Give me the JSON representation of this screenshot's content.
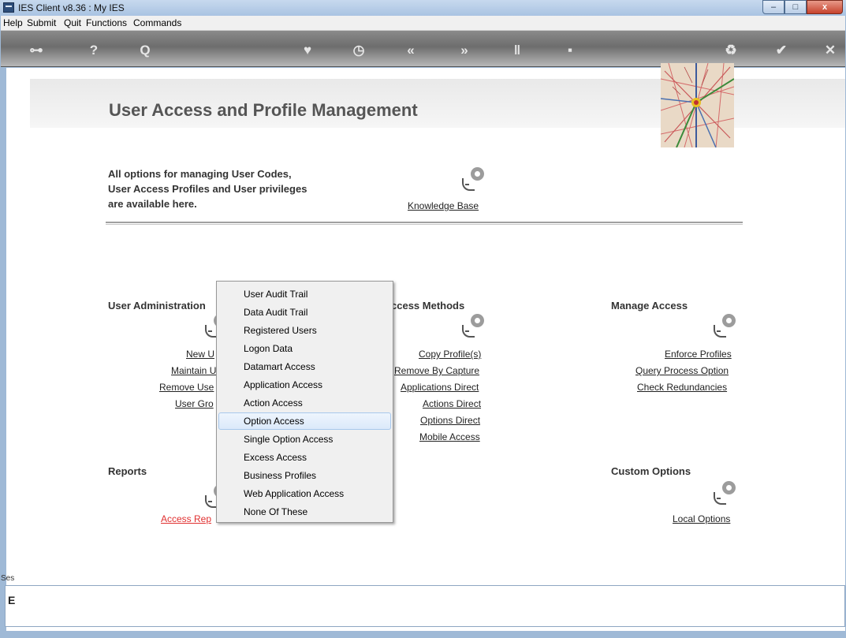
{
  "window": {
    "title": "IES Client v8.36 : My IES"
  },
  "window_controls": {
    "minimize": "–",
    "maximize": "□",
    "close": "x"
  },
  "menubar": [
    "Help",
    "Submit",
    "Quit",
    "Functions",
    "Commands"
  ],
  "toolbar": [
    {
      "icon": "key-icon",
      "glyph": "⊶"
    },
    {
      "icon": "help-icon",
      "glyph": "?"
    },
    {
      "icon": "search-icon",
      "glyph": "Q"
    },
    {
      "icon": "heart-icon",
      "glyph": "♥"
    },
    {
      "icon": "clock-icon",
      "glyph": "◷"
    },
    {
      "icon": "back-icon",
      "glyph": "«"
    },
    {
      "icon": "forward-icon",
      "glyph": "»"
    },
    {
      "icon": "tools-icon",
      "glyph": "ǁ"
    },
    {
      "icon": "calculator-icon",
      "glyph": "▪"
    },
    {
      "icon": "recycle-icon",
      "glyph": "♻"
    },
    {
      "icon": "check-icon",
      "glyph": "✔"
    },
    {
      "icon": "close-icon",
      "glyph": "✕"
    }
  ],
  "page": {
    "title": "User Access and Profile Management",
    "intro": [
      "All options for managing User Codes,",
      "User Access Profiles and User privileges",
      "are available here."
    ],
    "knowledge_base": "Knowledge Base"
  },
  "sections": {
    "user_admin": {
      "title": "User Administration",
      "links": [
        "New U",
        "Maintain U",
        "Remove Use",
        "User Gro"
      ]
    },
    "access_methods": {
      "title": "ccess Methods",
      "links": [
        "Copy Profile(s)",
        "Remove By Capture",
        "Applications Direct",
        "Actions Direct",
        "Options Direct",
        "Mobile Access"
      ]
    },
    "manage_access": {
      "title": "Manage Access",
      "links": [
        "Enforce Profiles",
        "Query Process Option",
        "Check Redundancies"
      ]
    },
    "reports": {
      "title": "Reports",
      "links": [
        "Access Rep"
      ]
    },
    "custom_options": {
      "title": "Custom Options",
      "links": [
        "Local Options"
      ]
    }
  },
  "popup_menu": {
    "items": [
      "User Audit Trail",
      "Data Audit Trail",
      "Registered Users",
      "Logon Data",
      "Datamart Access",
      "Application Access",
      "Action Access",
      "Option Access",
      "Single Option Access",
      "Excess Access",
      "Business Profiles",
      "Web Application Access",
      "None Of These"
    ],
    "highlighted": "Option Access"
  },
  "session": {
    "label": "Ses",
    "glyph": "E"
  },
  "colors": {
    "accent_link_red": "#e03030",
    "highlight": "#dbe9fa",
    "toolbar_bg": "#6d6d6d"
  }
}
